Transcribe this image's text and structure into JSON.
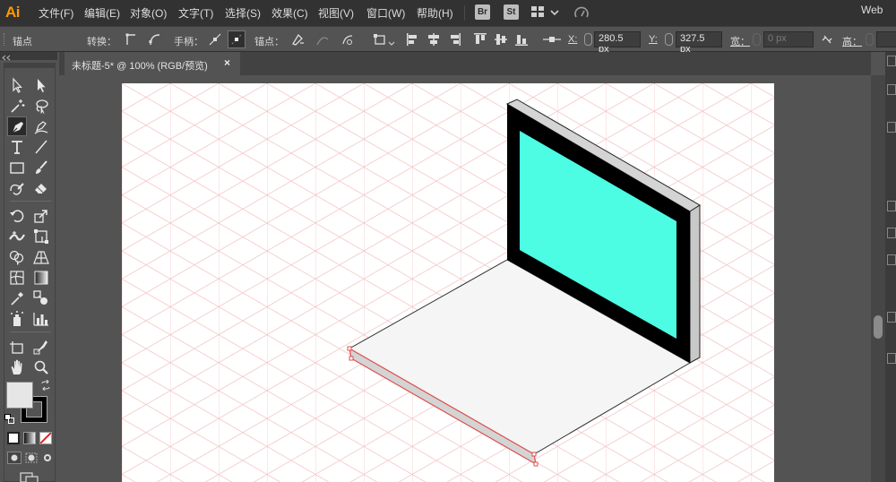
{
  "app": {
    "logo": "Ai"
  },
  "menu": {
    "items": [
      "文件(F)",
      "编辑(E)",
      "对象(O)",
      "文字(T)",
      "选择(S)",
      "效果(C)",
      "视图(V)",
      "窗口(W)",
      "帮助(H)"
    ],
    "bridge_badge": "Br",
    "stock_badge": "St",
    "workspace": "Web"
  },
  "control_bar": {
    "selection_label": "锚点",
    "convert_label": "转换：",
    "handles_label": "手柄：",
    "anchors_label": "锚点：",
    "x_label": "X:",
    "x_value": "280.5 px",
    "y_label": "Y:",
    "y_value": "327.5 px",
    "width_label": "宽：",
    "width_value": "0 px",
    "height_label": "高："
  },
  "document": {
    "tab_title": "未标题-5* @ 100% (RGB/预览)",
    "close_glyph": "×"
  },
  "artwork": {
    "screen_color": "#4dfde3",
    "bezel_color": "#000000",
    "frame_side_color": "#d4d4d4",
    "base_color": "#f5f5f5",
    "grid_color": "#f3c8c8",
    "selection_color": "#e05050"
  },
  "colors": {
    "fill_swatch": "#e6e6e6",
    "stroke_swatch": "#000000",
    "menubar_bg": "#323232",
    "panel_bg": "#535353",
    "logo_color": "#ff9a00"
  },
  "toolbar": {
    "tools": [
      "selection-tool",
      "direct-selection-tool",
      "magic-wand-tool",
      "lasso-tool",
      "pen-tool",
      "curvature-tool",
      "type-tool",
      "line-tool",
      "rectangle-tool",
      "paintbrush-tool",
      "shaper-tool",
      "eraser-tool",
      "rotate-tool",
      "scale-tool",
      "width-tool",
      "free-transform-tool",
      "shape-builder-tool",
      "perspective-grid-tool",
      "mesh-tool",
      "gradient-tool",
      "eyedropper-tool",
      "blend-tool",
      "symbol-sprayer-tool",
      "column-graph-tool",
      "artboard-tool",
      "slice-tool",
      "hand-tool",
      "zoom-tool"
    ]
  }
}
